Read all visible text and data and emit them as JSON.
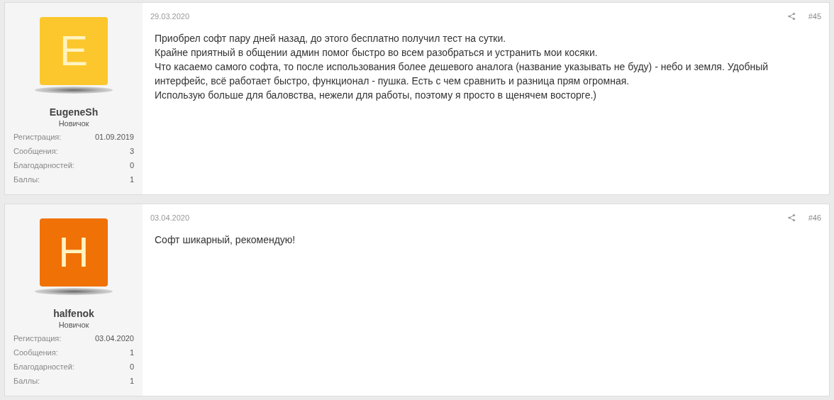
{
  "posts": [
    {
      "author": {
        "initial": "E",
        "color": "#fcc72c",
        "username": "EugeneSh",
        "rank": "Новичок",
        "stats": [
          {
            "label": "Регистрация:",
            "value": "01.09.2019"
          },
          {
            "label": "Сообщения:",
            "value": "3"
          },
          {
            "label": "Благодарностей:",
            "value": "0"
          },
          {
            "label": "Баллы:",
            "value": "1"
          }
        ]
      },
      "date": "29.03.2020",
      "number": "#45",
      "body": "Приобрел софт пару дней назад, до этого бесплатно получил тест на сутки.\nКрайне приятный в общении админ помог быстро во всем разобраться и устранить мои косяки.\nЧто касаемо самого софта, то после использования более дешевого аналога (название указывать не буду) - небо и земля. Удобный\nинтерфейс, всё работает быстро, функционал - пушка. Есть с чем сравнить и разница прям огромная.\nИспользую больше для баловства, нежели для работы, поэтому я просто в щенячем восторге.)"
    },
    {
      "author": {
        "initial": "H",
        "color": "#f07106",
        "username": "halfenok",
        "rank": "Новичок",
        "stats": [
          {
            "label": "Регистрация:",
            "value": "03.04.2020"
          },
          {
            "label": "Сообщения:",
            "value": "1"
          },
          {
            "label": "Благодарностей:",
            "value": "0"
          },
          {
            "label": "Баллы:",
            "value": "1"
          }
        ]
      },
      "date": "03.04.2020",
      "number": "#46",
      "body": "Софт шикарный, рекомендую!"
    }
  ]
}
